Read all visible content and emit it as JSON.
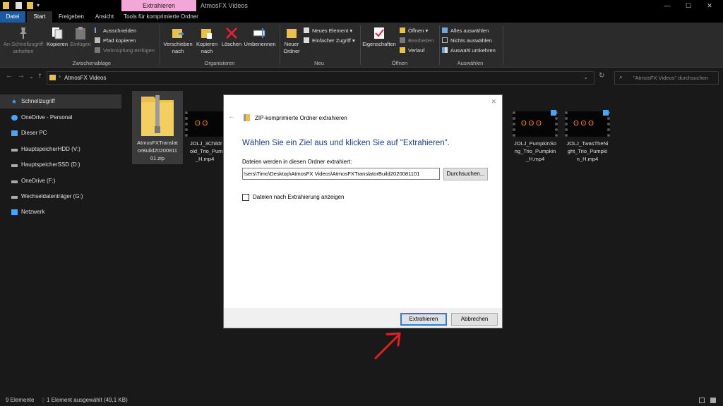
{
  "titlebar": {
    "context_tab": "Extrahieren",
    "window_title": "AtmosFX Videos",
    "minimize": "—",
    "maximize": "☐",
    "close": "✕"
  },
  "ribbon_tabs": [
    "Datei",
    "Start",
    "Freigeben",
    "Ansicht",
    "Tools für komprimierte Ordner"
  ],
  "ribbon": {
    "clipboard": {
      "pin_quick": "An Schnellzugriff anheften",
      "copy": "Kopieren",
      "paste": "Einfügen",
      "cut": "Ausschneiden",
      "copy_path": "Pfad kopieren",
      "paste_shortcut": "Verknüpfung einfügen",
      "group": "Zwischenablage"
    },
    "organize": {
      "move_to": "Verschieben nach",
      "copy_to": "Kopieren nach",
      "delete": "Löschen",
      "rename": "Umbenennen",
      "group": "Organisieren"
    },
    "new": {
      "new_folder": "Neuer Ordner",
      "new_item": "Neues Element",
      "easy_access": "Einfacher Zugriff",
      "group": "Neu"
    },
    "open": {
      "properties": "Eigenschaften",
      "open": "Öffnen",
      "edit": "Bearbeiten",
      "history": "Verlauf",
      "group": "Öffnen"
    },
    "select": {
      "select_all": "Alles auswählen",
      "select_none": "Nichts auswählen",
      "invert": "Auswahl umkehren",
      "group": "Auswählen"
    }
  },
  "address": {
    "path": "AtmosFX Videos",
    "search_placeholder": "\"AtmosFX Videos\" durchsuchen"
  },
  "sidebar": {
    "items": [
      {
        "label": "Schnellzugriff",
        "icon": "star-icon"
      },
      {
        "label": "OneDrive - Personal",
        "icon": "cloud-icon"
      },
      {
        "label": "Dieser PC",
        "icon": "pc-icon"
      },
      {
        "label": "HauptspeicherHDD (V:)",
        "icon": "drive-icon"
      },
      {
        "label": "HauptspeicherSSD (D:)",
        "icon": "drive-icon"
      },
      {
        "label": "OneDrive (F:)",
        "icon": "cloud-icon"
      },
      {
        "label": "Wechseldatenträger (G:)",
        "icon": "drive-icon"
      },
      {
        "label": "Netzwerk",
        "icon": "network-icon"
      }
    ]
  },
  "files": [
    {
      "name": "AtmosFXTranslatorBuild2020081101.zip",
      "lines": [
        "AtmosFXTranslat",
        "orBuild20200811",
        "01.zip"
      ]
    },
    {
      "name": "JOLJ_3ChildrenOld_Trio_Pumpkin_H.mp4",
      "lines": [
        "JOLJ_3Childr",
        "old_Trio_Pum",
        "_H.mp4"
      ]
    },
    {
      "name": "JOLJ_PumpkinSong_Trio_Pumpkin_H.mp4",
      "lines": [
        "JOLJ_PumpkinSo",
        "ng_Trio_Pumpkin",
        "_H.mp4"
      ]
    },
    {
      "name": "JOLJ_TwasTheNight_Trio_Pumpkin_H.mp4",
      "lines": [
        "JOLJ_TwasTheNi",
        "ght_Trio_Pumpki",
        "n_H.mp4"
      ]
    }
  ],
  "status": {
    "count": "9 Elemente",
    "selected": "1 Element ausgewählt (49,1 KB)"
  },
  "dialog": {
    "title": "ZIP-komprimierte Ordner extrahieren",
    "heading": "Wählen Sie ein Ziel aus und klicken Sie auf \"Extrahieren\".",
    "label": "Dateien werden in diesen Ordner extrahiert:",
    "path_value": "!sers\\Timo\\Desktop\\AtmosFX Videos\\AtmosFXTranslatorBuild2020081101",
    "browse": "Durchsuchen...",
    "checkbox_label": "Dateien nach Extrahierung anzeigen",
    "checkbox_checked": false,
    "extract": "Extrahieren",
    "cancel": "Abbrechen",
    "close": "✕",
    "back": "←"
  },
  "colors": {
    "accent": "#1c5aa0",
    "dialog_heading": "#1a3e8c",
    "annotation": "#e02020"
  }
}
